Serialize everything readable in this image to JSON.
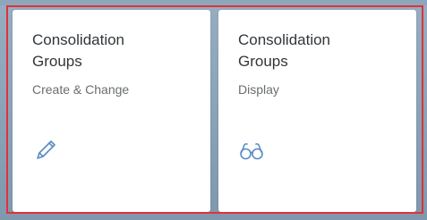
{
  "tiles": [
    {
      "title_line1": "Consolidation",
      "title_line2": "Groups",
      "subtitle": "Create & Change",
      "icon": "pencil-icon"
    },
    {
      "title_line1": "Consolidation",
      "title_line2": "Groups",
      "subtitle": "Display",
      "icon": "glasses-icon"
    }
  ],
  "colors": {
    "highlight": "#e0323a",
    "icon": "#5b8bc5",
    "title": "#32363a",
    "subtitle": "#6a6d70"
  }
}
